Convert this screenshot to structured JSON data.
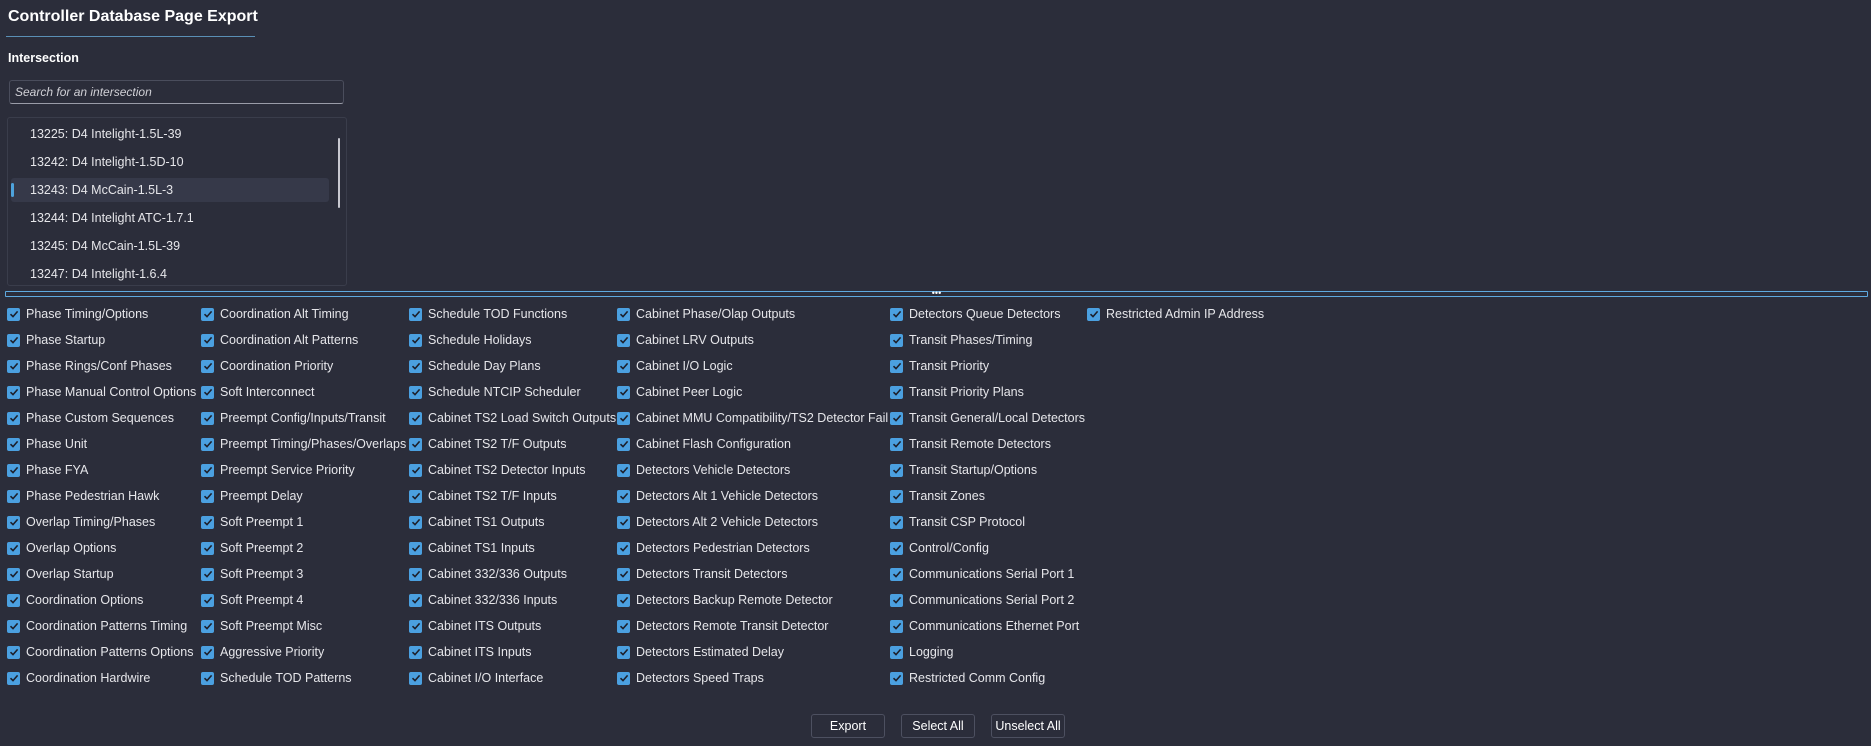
{
  "title": "Controller Database Page Export",
  "intersection_label": "Intersection",
  "search": {
    "placeholder": "Search for an intersection",
    "value": ""
  },
  "intersections": [
    {
      "label": "13225: D4 Intelight-1.5L-39",
      "selected": false
    },
    {
      "label": "13242: D4 Intelight-1.5D-10",
      "selected": false
    },
    {
      "label": "13243: D4 McCain-1.5L-3",
      "selected": true
    },
    {
      "label": "13244: D4 Intelight ATC-1.7.1",
      "selected": false
    },
    {
      "label": "13245: D4 McCain-1.5L-39",
      "selected": false
    },
    {
      "label": "13247: D4 Intelight-1.6.4",
      "selected": false
    }
  ],
  "splitter_grip": "•••",
  "columns": [
    [
      "Phase Timing/Options",
      "Phase Startup",
      "Phase Rings/Conf Phases",
      "Phase Manual Control Options",
      "Phase Custom Sequences",
      "Phase Unit",
      "Phase FYA",
      "Phase Pedestrian Hawk",
      "Overlap Timing/Phases",
      "Overlap Options",
      "Overlap Startup",
      "Coordination Options",
      "Coordination Patterns Timing",
      "Coordination Patterns Options",
      "Coordination Hardwire"
    ],
    [
      "Coordination Alt Timing",
      "Coordination Alt Patterns",
      "Coordination Priority",
      "Soft Interconnect",
      "Preempt Config/Inputs/Transit",
      "Preempt Timing/Phases/Overlaps",
      "Preempt Service Priority",
      "Preempt Delay",
      "Soft Preempt 1",
      "Soft Preempt 2",
      "Soft Preempt 3",
      "Soft Preempt 4",
      "Soft Preempt Misc",
      "Aggressive Priority",
      "Schedule TOD Patterns"
    ],
    [
      "Schedule TOD Functions",
      "Schedule Holidays",
      "Schedule Day Plans",
      "Schedule NTCIP Scheduler",
      "Cabinet TS2 Load Switch Outputs",
      "Cabinet TS2 T/F Outputs",
      "Cabinet TS2 Detector Inputs",
      "Cabinet TS2 T/F Inputs",
      "Cabinet TS1 Outputs",
      "Cabinet TS1 Inputs",
      "Cabinet 332/336 Outputs",
      "Cabinet 332/336 Inputs",
      "Cabinet ITS Outputs",
      "Cabinet ITS Inputs",
      "Cabinet I/O Interface"
    ],
    [
      "Cabinet Phase/Olap Outputs",
      "Cabinet LRV Outputs",
      "Cabinet I/O Logic",
      "Cabinet Peer Logic",
      "Cabinet MMU Compatibility/TS2 Detector Fail",
      "Cabinet Flash Configuration",
      "Detectors Vehicle Detectors",
      "Detectors Alt 1 Vehicle Detectors",
      "Detectors Alt 2 Vehicle Detectors",
      "Detectors Pedestrian Detectors",
      "Detectors Transit Detectors",
      "Detectors Backup Remote Detector",
      "Detectors Remote Transit Detector",
      "Detectors Estimated Delay",
      "Detectors Speed Traps"
    ],
    [
      "Detectors Queue Detectors",
      "Transit Phases/Timing",
      "Transit Priority",
      "Transit Priority Plans",
      "Transit General/Local Detectors",
      "Transit Remote Detectors",
      "Transit Startup/Options",
      "Transit Zones",
      "Transit CSP Protocol",
      "Control/Config",
      "Communications Serial Port 1",
      "Communications Serial Port 2",
      "Communications Ethernet Port",
      "Logging",
      "Restricted Comm Config"
    ],
    [
      "Restricted Admin IP Address"
    ]
  ],
  "buttons": {
    "export": "Export",
    "select_all": "Select All",
    "unselect_all": "Unselect All"
  },
  "colors": {
    "background": "#2b2d3a",
    "accent": "#4ba0e0",
    "text": "#e6e6ea"
  }
}
